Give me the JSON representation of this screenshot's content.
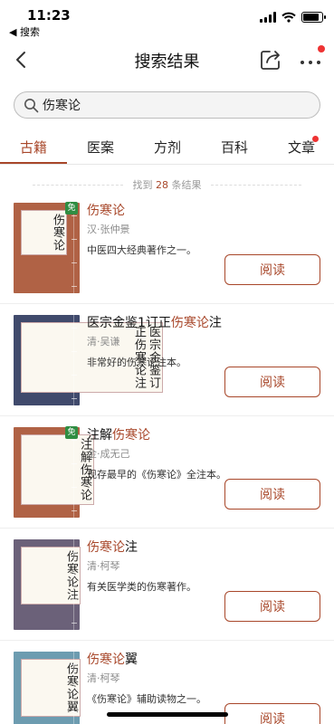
{
  "status_bar": {
    "time": "11:23",
    "back_app": "◀ 搜索",
    "battery_level": 0.85
  },
  "nav": {
    "title": "搜索结果"
  },
  "search": {
    "value": "伤寒论",
    "placeholder": ""
  },
  "tabs": [
    {
      "label": "古籍",
      "active": true
    },
    {
      "label": "医案",
      "active": false
    },
    {
      "label": "方剂",
      "active": false
    },
    {
      "label": "百科",
      "active": false
    },
    {
      "label": "文章",
      "active": false,
      "badge": true
    }
  ],
  "result_count": {
    "prefix": "找到",
    "count": "28",
    "suffix": "条结果"
  },
  "results": [
    {
      "title_pre": "",
      "title_hl": "伤寒论",
      "title_post": "",
      "author": "汉·张仲景",
      "desc": "中医四大经典著作之一。",
      "button": "阅读",
      "free": true,
      "free_label": "免",
      "cover_color": "#b06245",
      "cover_cols": [
        "伤寒论"
      ]
    },
    {
      "title_pre": "医宗金鉴1订正",
      "title_hl": "伤寒论",
      "title_post": "注",
      "author": "清·吴谦",
      "desc": "非常好的伤寒论注本。",
      "button": "阅读",
      "free": false,
      "free_label": "",
      "cover_color": "#404a6c",
      "cover_cols": [
        "医宗金鉴订",
        "正伤寒论注"
      ]
    },
    {
      "title_pre": "注解",
      "title_hl": "伤寒论",
      "title_post": "",
      "author": "金·成无己",
      "desc": "现存最早的《伤寒论》全注本。",
      "button": "阅读",
      "free": true,
      "free_label": "免",
      "cover_color": "#b06245",
      "cover_cols": [
        "注解伤寒论"
      ]
    },
    {
      "title_pre": "",
      "title_hl": "伤寒论",
      "title_post": "注",
      "author": "清·柯琴",
      "desc": "有关医学类的伤寒著作。",
      "button": "阅读",
      "free": false,
      "free_label": "",
      "cover_color": "#6b6179",
      "cover_cols": [
        "伤寒论注"
      ]
    },
    {
      "title_pre": "",
      "title_hl": "伤寒论",
      "title_post": "翼",
      "author": "清·柯琴",
      "desc": "《伤寒论》辅助读物之一。",
      "button": "阅读",
      "free": false,
      "free_label": "",
      "cover_color": "#6d9cb0",
      "cover_cols": [
        "伤寒论翼"
      ]
    }
  ]
}
